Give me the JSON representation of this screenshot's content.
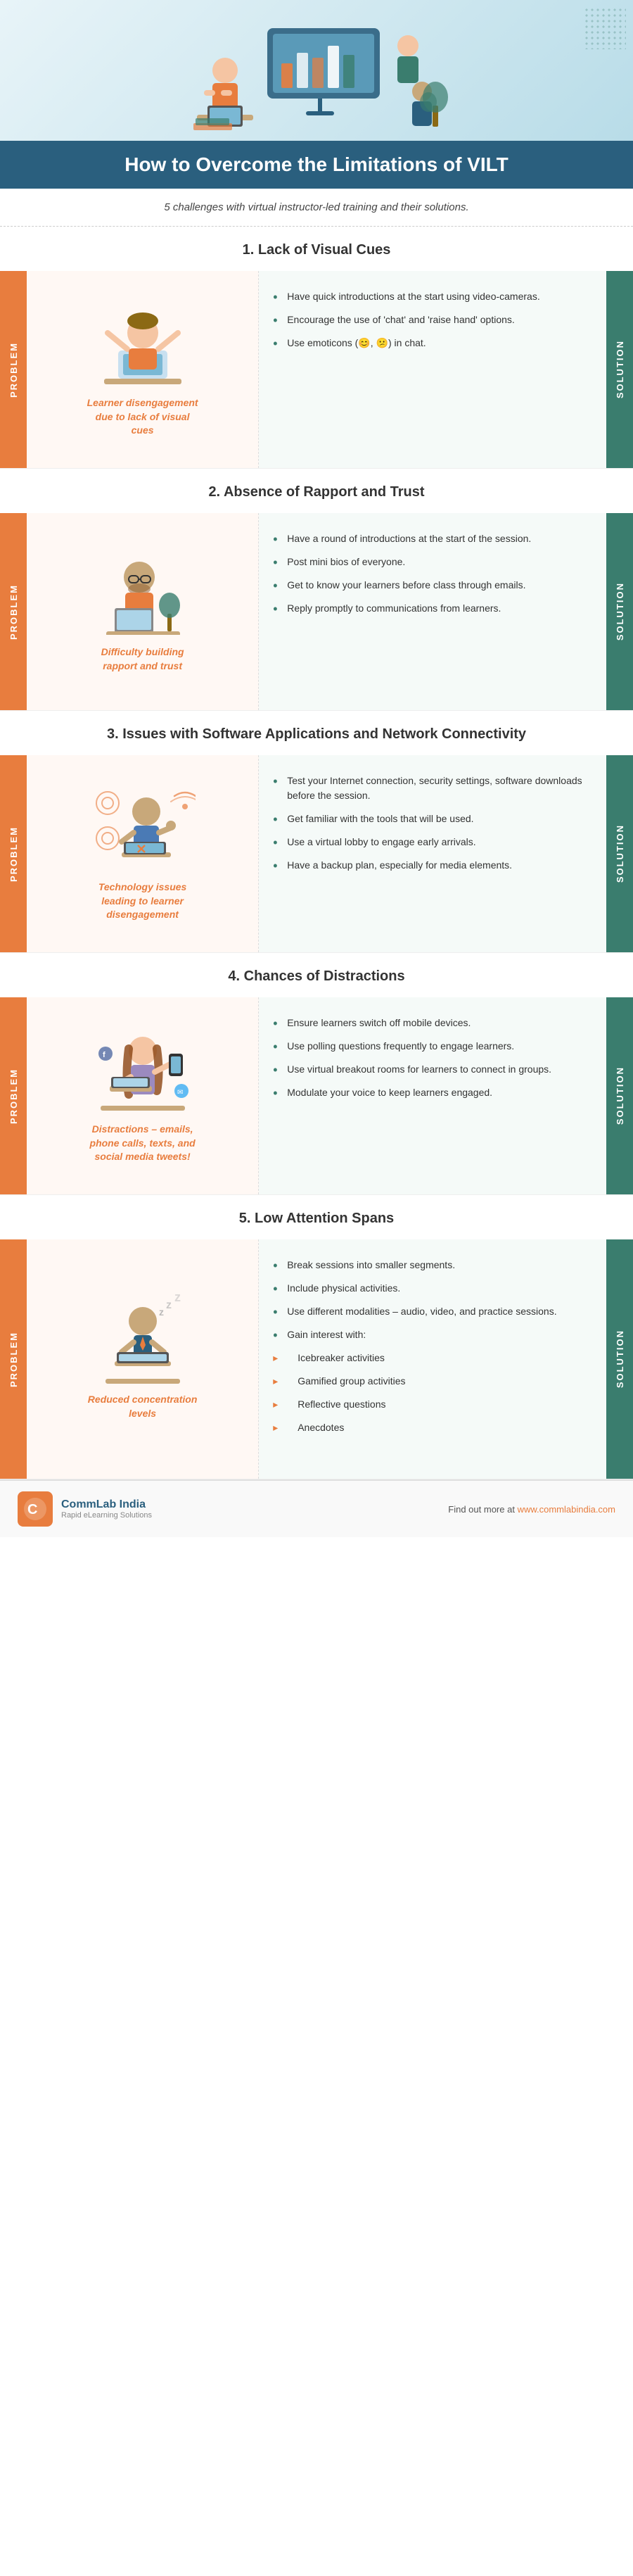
{
  "header": {
    "title": "How to Overcome the Limitations of VILT",
    "subtitle": "5 challenges with virtual instructor-led training and their solutions."
  },
  "sections": [
    {
      "number": "1.",
      "title": "Lack of Visual Cues",
      "problem_text": "Learner disengagement due to lack of visual cues",
      "solutions": [
        "Have quick introductions at the start using video-cameras.",
        "Encourage the use of 'chat' and 'raise hand' options.",
        "Use emoticons (😊, 😕) in chat."
      ],
      "sub_solutions": []
    },
    {
      "number": "2.",
      "title": "Absence of Rapport and Trust",
      "problem_text": "Difficulty building rapport and trust",
      "solutions": [
        "Have a round of introductions at the start of the session.",
        "Post mini bios of everyone.",
        "Get to know your learners before class through emails.",
        "Reply promptly to communications from learners."
      ],
      "sub_solutions": []
    },
    {
      "number": "3.",
      "title": "Issues with Software Applications and Network Connectivity",
      "problem_text": "Technology issues leading to learner disengagement",
      "solutions": [
        "Test your Internet connection, security settings, software downloads before the session.",
        "Get familiar with the tools that will be used.",
        "Use a virtual lobby to engage early arrivals.",
        "Have a backup plan, especially for media elements."
      ],
      "sub_solutions": []
    },
    {
      "number": "4.",
      "title": "Chances of Distractions",
      "problem_text": "Distractions – emails, phone calls, texts, and social media tweets!",
      "solutions": [
        "Ensure learners switch off mobile devices.",
        "Use polling questions frequently to engage learners.",
        "Use virtual breakout rooms for learners to connect in groups.",
        "Modulate your voice to keep learners engaged."
      ],
      "sub_solutions": []
    },
    {
      "number": "5.",
      "title": "Low Attention Spans",
      "problem_text": "Reduced concentration levels",
      "solutions": [
        "Break sessions into smaller segments.",
        "Include physical activities.",
        "Use different modalities – audio, video, and practice sessions.",
        "Gain interest with:"
      ],
      "sub_solutions": [
        "Icebreaker activities",
        "Gamified group activities",
        "Reflective questions",
        "Anecdotes"
      ]
    }
  ],
  "footer": {
    "brand_name": "CommLab India",
    "tagline": "Rapid eLearning Solutions",
    "cta": "Find out more at",
    "url": "www.commlabindia.com"
  },
  "labels": {
    "problem": "PROBLEM",
    "solution": "SOLUTION"
  }
}
